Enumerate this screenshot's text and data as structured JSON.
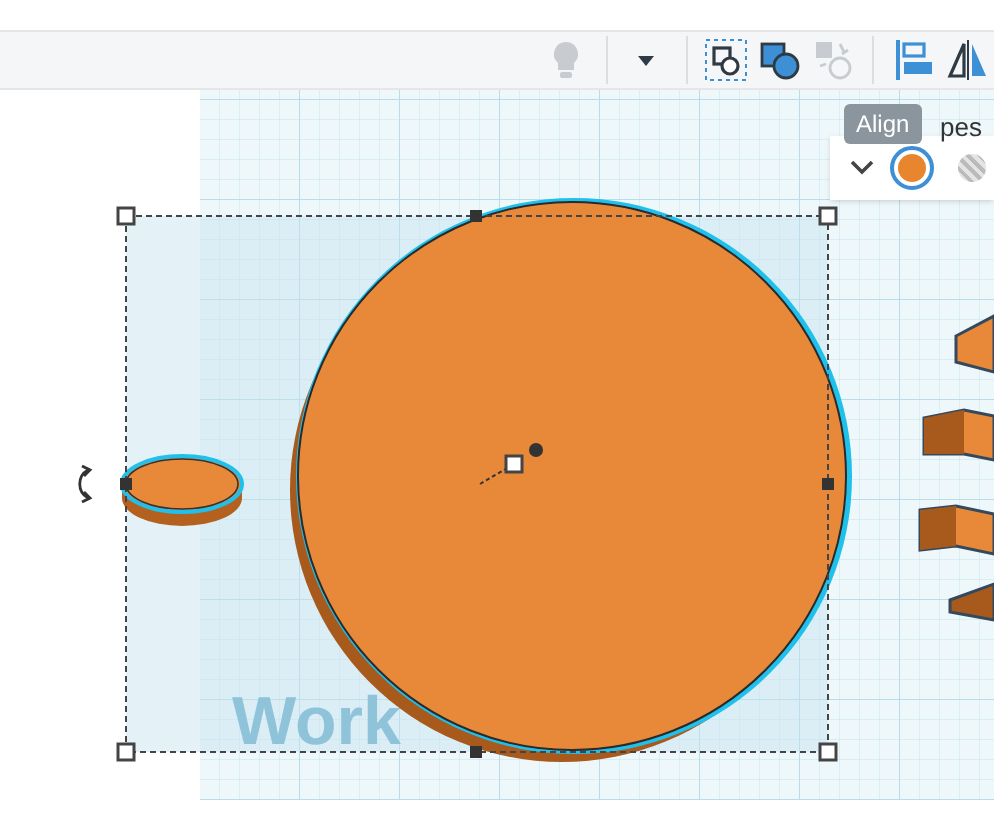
{
  "toolbar": {
    "tools": [
      {
        "kind": "lightbulb",
        "disabled": true
      },
      {
        "kind": "dropdown",
        "disabled": false
      },
      {
        "kind": "group",
        "disabled": false
      },
      {
        "kind": "union",
        "disabled": false
      },
      {
        "kind": "ungroup",
        "disabled": true
      },
      {
        "kind": "align",
        "disabled": false
      },
      {
        "kind": "mirror",
        "disabled": false
      }
    ]
  },
  "tooltip": {
    "text": "Align"
  },
  "shape_panel": {
    "title": "pes",
    "colors": [
      {
        "kind": "solid",
        "color": "#e8862f",
        "selected": true
      },
      {
        "kind": "hatched",
        "selected": false
      }
    ]
  },
  "workplane": {
    "label": "Work"
  }
}
